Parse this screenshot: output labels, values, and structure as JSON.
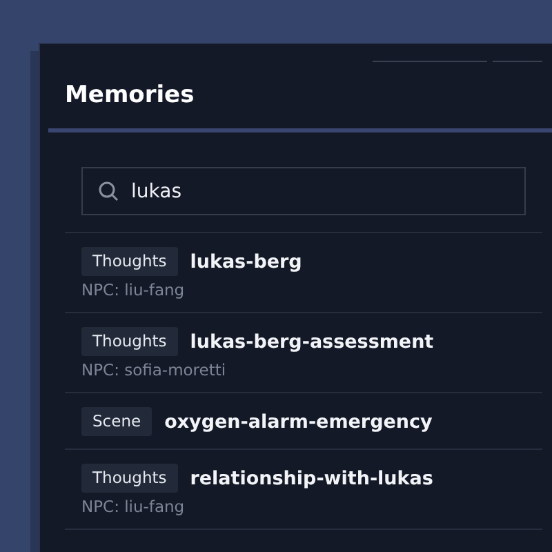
{
  "panel": {
    "title": "Memories"
  },
  "search": {
    "value": "lukas"
  },
  "memories": [
    {
      "tag": "Thoughts",
      "name": "lukas-berg",
      "npc": "NPC: liu-fang"
    },
    {
      "tag": "Thoughts",
      "name": "lukas-berg-assessment",
      "npc": "NPC: sofia-moretti"
    },
    {
      "tag": "Scene",
      "name": "oxygen-alarm-emergency"
    },
    {
      "tag": "Thoughts",
      "name": "relationship-with-lukas",
      "npc": "NPC: liu-fang"
    }
  ]
}
